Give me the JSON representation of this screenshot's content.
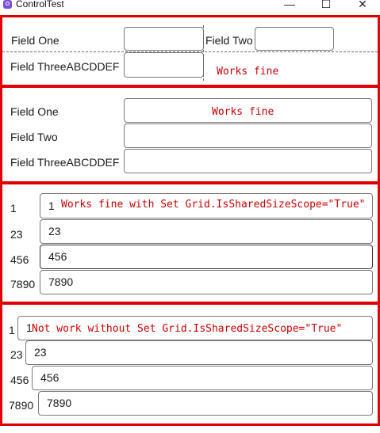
{
  "window": {
    "title": "ControlTest",
    "minimize_glyph": "—",
    "maximize_glyph": "☐",
    "close_glyph": "✕"
  },
  "panel1": {
    "field_one_label": "Field One",
    "field_two_label": "Field Two",
    "field_three_label": "Field ThreeABCDDEF",
    "field_one_value": "",
    "field_two_value": "",
    "field_three_value": "",
    "note": "Works fine"
  },
  "panel2": {
    "field_one_label": "Field One",
    "field_two_label": "Field Two",
    "field_three_label": "Field ThreeABCDDEF",
    "note": "Works fine",
    "field_two_value": "",
    "field_three_value": ""
  },
  "panel3": {
    "rows": [
      {
        "label": "1",
        "value": "1"
      },
      {
        "label": "23",
        "value": "23"
      },
      {
        "label": "456",
        "value": "456"
      },
      {
        "label": "7890",
        "value": "7890"
      }
    ],
    "note": "Works fine with Set Grid.IsSharedSizeScope=\"True\""
  },
  "panel4": {
    "rows": [
      {
        "label": "1",
        "value": "1"
      },
      {
        "label": "23",
        "value": "23"
      },
      {
        "label": "456",
        "value": "456"
      },
      {
        "label": "7890",
        "value": "7890"
      }
    ],
    "note": "Not work without Set Grid.IsSharedSizeScope=\"True\""
  },
  "colors": {
    "panel_border": "#e00000",
    "note_text": "#cc0000",
    "textbox_border": "#7a7a7a",
    "app_icon": "#7a4fd6"
  },
  "icons": {
    "app": "app-icon"
  }
}
